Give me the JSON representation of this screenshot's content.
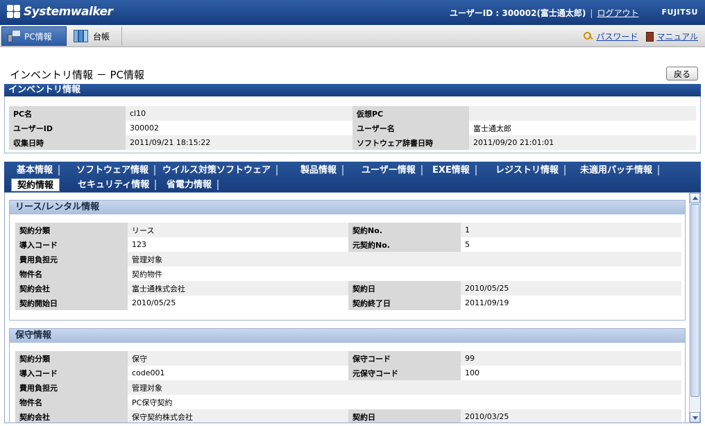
{
  "header": {
    "app_name": "Systemwalker",
    "user_label": "ユーザーID : 300002(富士通太郎)",
    "logout": "ログアウト",
    "brand": "FUJITSU"
  },
  "nav": {
    "tabs": [
      {
        "label": "PC情報",
        "icon": "pc-icon",
        "active": true
      },
      {
        "label": "台帳",
        "icon": "ledger-icon",
        "active": false
      }
    ],
    "password": "パスワード",
    "manual": "マニュアル"
  },
  "page": {
    "title": "インベントリ情報 － PC情報",
    "back": "戻る",
    "section_title": "インベントリ情報"
  },
  "inventory": [
    {
      "l1": "PC名",
      "v1": "cl10",
      "l2": "仮想PC",
      "v2": ""
    },
    {
      "l1": "ユーザーID",
      "v1": "300002",
      "l2": "ユーザー名",
      "v2": "富士通太郎"
    },
    {
      "l1": "収集日時",
      "v1": "2011/09/21 18:15:22",
      "l2": "ソフトウェア辞書日時",
      "v2": "2011/09/20 21:01:01"
    }
  ],
  "tabs_row1": [
    "基本情報",
    "ソフトウェア情報",
    "ウイルス対策ソフトウェア",
    "製品情報",
    "ユーザー情報",
    "EXE情報",
    "レジストリ情報",
    "未適用パッチ情報"
  ],
  "tabs_row2": [
    "契約情報",
    "セキュリティ情報",
    "省電力情報"
  ],
  "active_tab": "契約情報",
  "lease": {
    "title": "リース/レンタル情報",
    "rows": [
      {
        "l1": "契約分類",
        "v1": "リース",
        "l2": "契約No.",
        "v2": "1"
      },
      {
        "l1": "導入コード",
        "v1": "123",
        "l2": "元契約No.",
        "v2": "5"
      },
      {
        "l1": "費用負担元",
        "v1": "管理対象"
      },
      {
        "l1": "物件名",
        "v1": "契約物件"
      },
      {
        "l1": "契約会社",
        "v1": "富士通株式会社",
        "l2": "契約日",
        "v2": "2010/05/25"
      },
      {
        "l1": "契約開始日",
        "v1": "2010/05/25",
        "l2": "契約終了日",
        "v2": "2011/09/19"
      }
    ]
  },
  "maintenance": {
    "title": "保守情報",
    "rows": [
      {
        "l1": "契約分類",
        "v1": "保守",
        "l2": "保守コード",
        "v2": "99"
      },
      {
        "l1": "導入コード",
        "v1": "code001",
        "l2": "元保守コード",
        "v2": "100"
      },
      {
        "l1": "費用負担元",
        "v1": "管理対象"
      },
      {
        "l1": "物件名",
        "v1": "PC保守契約"
      },
      {
        "l1": "契約会社",
        "v1": "保守契約株式会社",
        "l2": "契約日",
        "v2": "2010/03/25"
      }
    ]
  },
  "colors": {
    "header": "#1f4a8f",
    "tab_strip": "#1f4785",
    "label_bg": "#d9d9d9"
  }
}
